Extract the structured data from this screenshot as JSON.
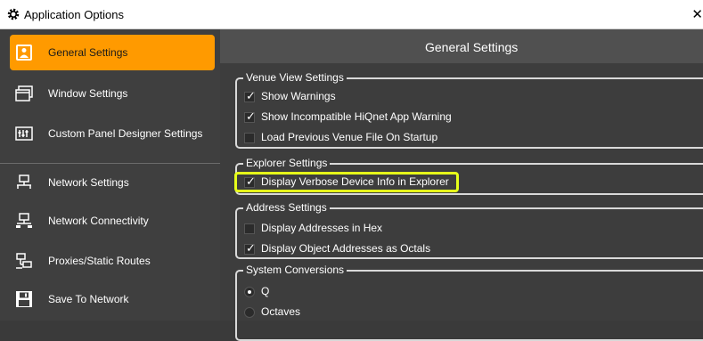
{
  "window": {
    "title": "Application Options",
    "close_glyph": "✕"
  },
  "sidebar": {
    "items": [
      {
        "label": "General Settings",
        "icon": "general-settings-icon",
        "active": true
      },
      {
        "label": "Window Settings",
        "icon": "window-icon"
      },
      {
        "label": "Custom Panel Designer Settings",
        "icon": "panel-designer-icon"
      },
      {
        "label": "Network Settings",
        "icon": "network-icon"
      },
      {
        "label": "Network Connectivity",
        "icon": "network-connectivity-icon"
      },
      {
        "label": "Proxies/Static Routes",
        "icon": "proxies-icon"
      },
      {
        "label": "Save To Network",
        "icon": "save-network-icon"
      }
    ]
  },
  "main": {
    "title": "General Settings",
    "venue": {
      "legend": "Venue View Settings",
      "items": [
        {
          "label": "Show Warnings",
          "checked": true
        },
        {
          "label": "Show Incompatible HiQnet App Warning",
          "checked": true
        },
        {
          "label": "Load Previous Venue File On Startup",
          "checked": false
        }
      ]
    },
    "explorer": {
      "legend": "Explorer Settings",
      "items": [
        {
          "label": "Display Verbose Device Info in Explorer",
          "checked": true
        }
      ]
    },
    "address": {
      "legend": "Address Settings",
      "items": [
        {
          "label": "Display Addresses in Hex",
          "checked": false
        },
        {
          "label": "Display Object Addresses as Octals",
          "checked": true
        }
      ]
    },
    "conversions": {
      "legend": "System Conversions",
      "options": [
        {
          "label": "Q",
          "selected": true
        },
        {
          "label": "Octaves",
          "selected": false
        }
      ]
    }
  },
  "colors": {
    "accent": "#ff9a00",
    "highlight": "#e6ff1a"
  }
}
